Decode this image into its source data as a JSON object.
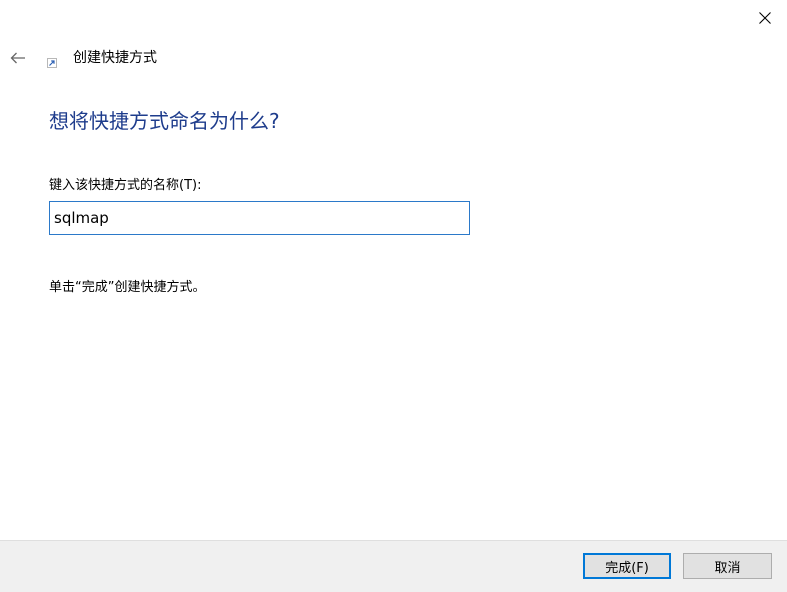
{
  "window": {
    "close_icon": "close-icon",
    "back_icon": "back-arrow-icon",
    "wizard_icon": "shortcut-icon"
  },
  "header": {
    "title": "创建快捷方式"
  },
  "main": {
    "heading": "想将快捷方式命名为什么?",
    "field_label": "键入该快捷方式的名称(T):",
    "name_value": "sqlmap",
    "hint": "单击“完成”创建快捷方式。"
  },
  "footer": {
    "finish_label": "完成(F)",
    "cancel_label": "取消"
  },
  "colors": {
    "heading": "#1e3c8c",
    "input_border": "#2b79c9",
    "default_button_border": "#0078d7",
    "footer_bg": "#f0f0f0"
  }
}
